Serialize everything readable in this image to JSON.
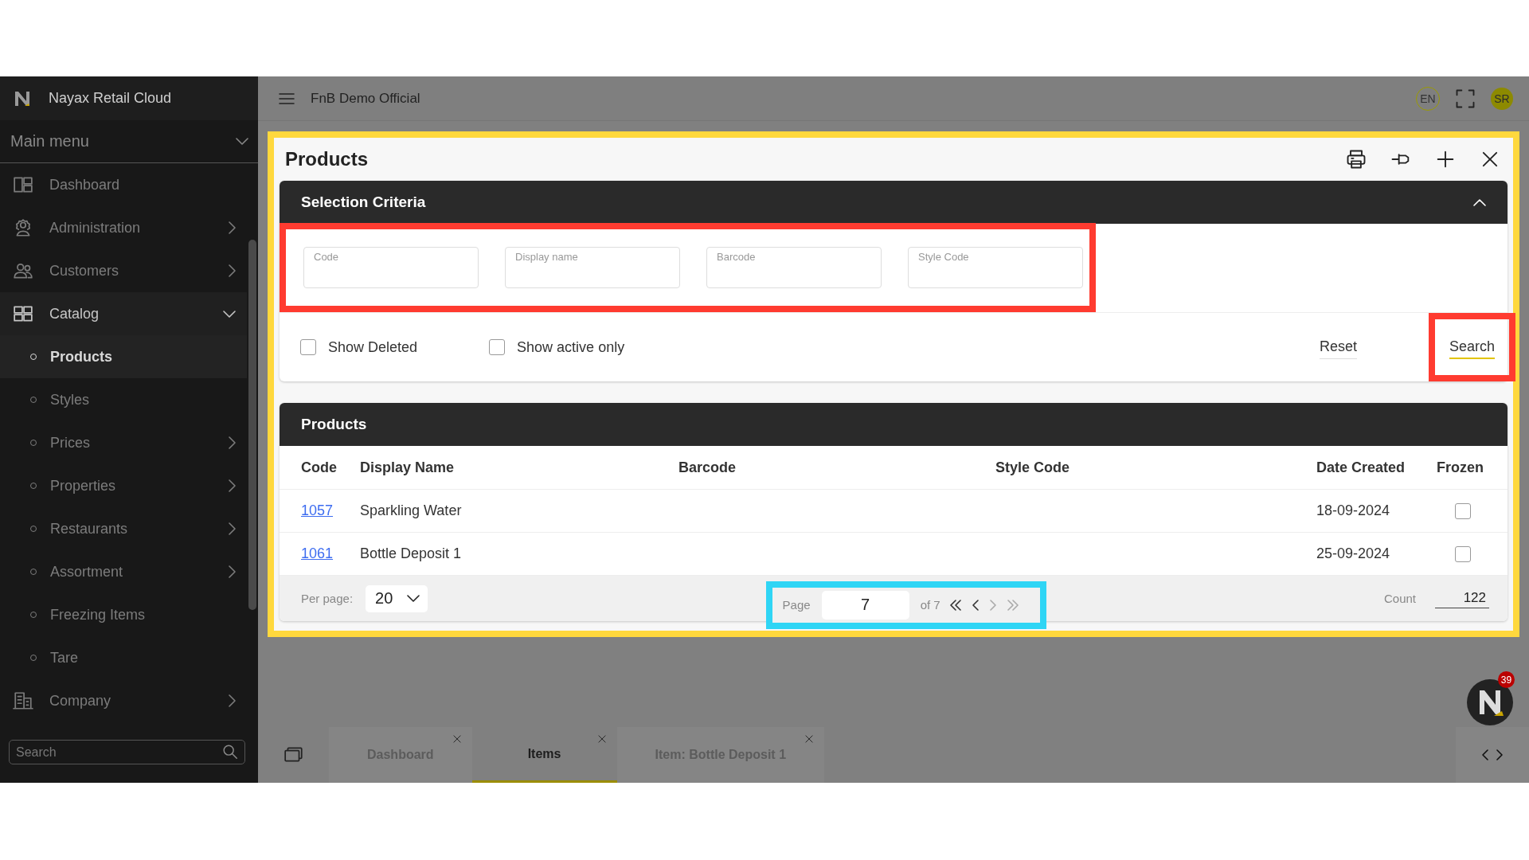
{
  "app": {
    "brand": "Nayax Retail Cloud",
    "store": "FnB Demo Official",
    "language": "EN",
    "user_initials": "SR",
    "notifications": "39"
  },
  "sidebar": {
    "header": "Main menu",
    "header_expanded": true,
    "items": [
      {
        "label": "Dashboard",
        "kind": "dashboard",
        "has_submenu": false,
        "expanded": false
      },
      {
        "label": "Administration",
        "kind": "admin",
        "has_submenu": true,
        "expanded": false
      },
      {
        "label": "Customers",
        "kind": "people",
        "has_submenu": true,
        "expanded": false
      },
      {
        "label": "Catalog",
        "kind": "catalog",
        "has_submenu": true,
        "expanded": true,
        "children": [
          {
            "label": "Products",
            "has_submenu": false,
            "selected": true
          },
          {
            "label": "Styles",
            "has_submenu": false,
            "selected": false
          },
          {
            "label": "Prices",
            "has_submenu": true,
            "selected": false
          },
          {
            "label": "Properties",
            "has_submenu": true,
            "selected": false
          },
          {
            "label": "Restaurants",
            "has_submenu": true,
            "selected": false
          },
          {
            "label": "Assortment",
            "has_submenu": true,
            "selected": false
          },
          {
            "label": "Freezing Items",
            "has_submenu": false,
            "selected": false
          },
          {
            "label": "Tare",
            "has_submenu": false,
            "selected": false
          }
        ]
      },
      {
        "label": "Company",
        "kind": "building",
        "has_submenu": true,
        "expanded": false
      }
    ],
    "search": {
      "placeholder": "Search"
    }
  },
  "highlights": [
    {
      "kind": "panel",
      "color": "#ffd83d"
    },
    {
      "kind": "fields",
      "color": "#ff3b30"
    },
    {
      "kind": "search",
      "color": "#ff3b30"
    },
    {
      "kind": "pager",
      "color": "#2fd5f5"
    }
  ],
  "panel": {
    "title": "Products",
    "criteria": {
      "title": "Selection Criteria",
      "expanded": true,
      "fields": [
        {
          "label": "Code"
        },
        {
          "label": "Display name"
        },
        {
          "label": "Barcode"
        },
        {
          "label": "Style Code"
        }
      ],
      "checkboxes": [
        {
          "label": "Show Deleted",
          "checked": false
        },
        {
          "label": "Show active only",
          "checked": false
        }
      ],
      "reset": "Reset",
      "search": "Search"
    },
    "results": {
      "title": "Products",
      "columns": [
        "Code",
        "Display Name",
        "Barcode",
        "Style Code",
        "Date Created",
        "Frozen"
      ],
      "rows": [
        {
          "code": "1057",
          "display_name": "Sparkling Water",
          "date_created": "18-09-2024",
          "frozen": false
        },
        {
          "code": "1061",
          "display_name": "Bottle Deposit 1",
          "date_created": "25-09-2024",
          "frozen": false
        }
      ],
      "footer": {
        "per_page_label": "Per page:",
        "per_page": "20",
        "page_label": "Page",
        "page": "7",
        "page_total": "of 7",
        "nav": [
          {
            "kind": "first",
            "disabled": false
          },
          {
            "kind": "prev",
            "disabled": false
          },
          {
            "kind": "next",
            "disabled": true
          },
          {
            "kind": "last",
            "disabled": true
          }
        ],
        "count_label": "Count",
        "count": "122"
      }
    }
  },
  "tabs": [
    {
      "label": "Dashboard",
      "selected": false
    },
    {
      "label": "Items",
      "selected": true
    },
    {
      "label": "Item: Bottle Deposit 1",
      "selected": false
    }
  ]
}
